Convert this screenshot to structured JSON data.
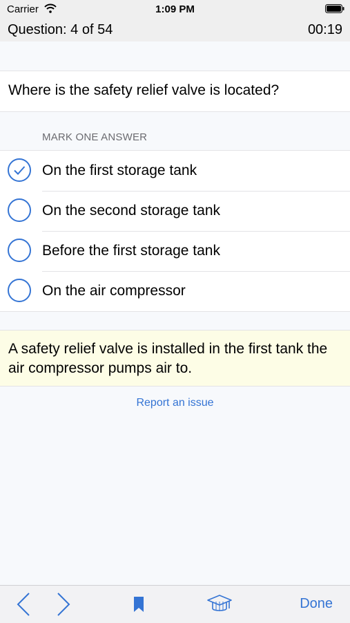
{
  "status": {
    "carrier": "Carrier",
    "time": "1:09 PM"
  },
  "header": {
    "counter": "Question: 4 of 54",
    "timer": "00:19"
  },
  "question": {
    "text": "Where is the safety relief valve is located?"
  },
  "mark_label": "MARK ONE ANSWER",
  "answers": [
    {
      "text": "On the first storage tank",
      "selected": true
    },
    {
      "text": "On the second storage tank",
      "selected": false
    },
    {
      "text": "Before the first storage tank",
      "selected": false
    },
    {
      "text": "On the air compressor",
      "selected": false
    }
  ],
  "explanation": "A safety relief valve is installed in the first tank the air compressor pumps air to.",
  "report_link": "Report an issue",
  "toolbar": {
    "done": "Done",
    "icons": [
      "chevron-left-icon",
      "chevron-right-icon",
      "bookmark-icon",
      "graduation-cap-icon"
    ]
  },
  "colors": {
    "accent": "#3474d4",
    "explanation_bg": "#fdfde6",
    "header_bg": "#efefef"
  }
}
